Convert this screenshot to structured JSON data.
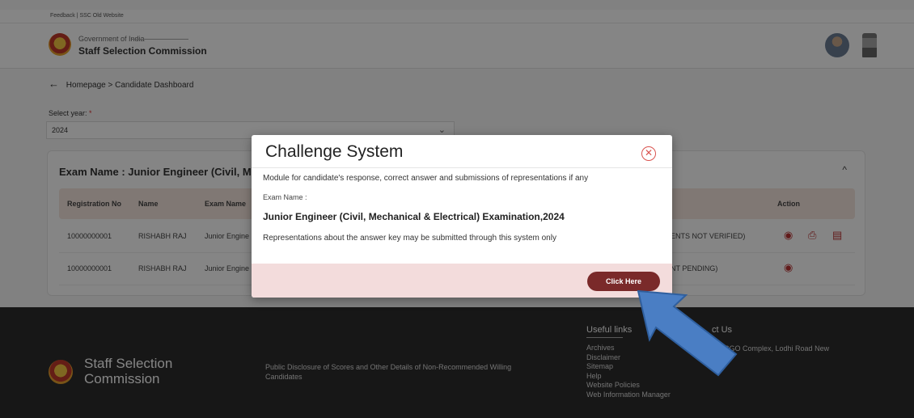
{
  "topbar": {
    "links": "Feedback | SSC Old Website"
  },
  "header": {
    "gov": "Government of India",
    "org": "Staff Selection Commission"
  },
  "breadcrumb": {
    "home": "Homepage",
    "sep": ">",
    "current": "Candidate Dashboard"
  },
  "year": {
    "label": "Select year:",
    "required": "*",
    "value": "2024"
  },
  "exam_card": {
    "title": "Exam Name : Junior Engineer (Civil, Mech",
    "columns": [
      "Registration No",
      "Name",
      "Exam Name",
      "Action"
    ],
    "rows": [
      {
        "reg": "10000000001",
        "name": "RISHABH RAJ",
        "exam": "Junior Engine",
        "status": "ENTS NOT VERIFIED)"
      },
      {
        "reg": "10000000001",
        "name": "RISHABH RAJ",
        "exam": "Junior Engine",
        "status": "NT PENDING)"
      }
    ]
  },
  "footer": {
    "brand_line1": "Staff Selection",
    "brand_line2": "Commission",
    "disclosure": "Public Disclosure of Scores and Other Details of Non-Recommended Willing Candidates",
    "useful_links_title": "Useful links",
    "useful_links": [
      "Archives",
      "Disclaimer",
      "Sitemap",
      "Help",
      "Website Policies",
      "Web Information Manager"
    ],
    "contact_title": "ct Us",
    "contact_text": "12, CGO Complex, Lodhi Road New"
  },
  "modal": {
    "title": "Challenge System",
    "close_symbol": "✕",
    "description": "Module for candidate's response, correct answer and submissions of representations if any",
    "exam_label": "Exam Name :",
    "exam_value": "Junior Engineer (Civil, Mechanical & Electrical) Examination,2024",
    "note": "Representations about the answer key may be submitted through this system only",
    "button_label": "Click Here"
  },
  "colors": {
    "button": "#7a2a2a",
    "modal_footer": "#f3dcdc",
    "arrow": "#4a7ec4",
    "close": "#d9534f"
  }
}
